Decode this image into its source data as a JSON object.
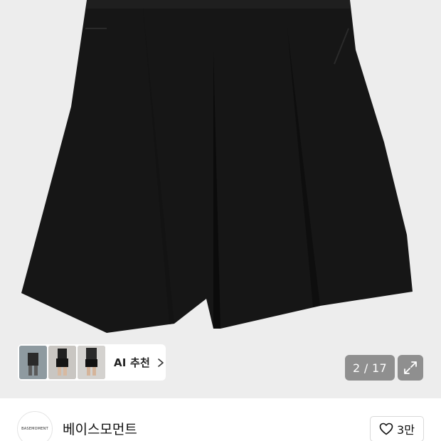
{
  "gallery": {
    "recommend_label": "AI 추천",
    "counter": "2 / 17",
    "thumbnails": [
      "thumbnail-1",
      "thumbnail-2",
      "thumbnail-3"
    ],
    "icons": {
      "chevron": "chevron-right-icon",
      "expand": "expand-icon"
    }
  },
  "brand": {
    "name": "베이스모먼트",
    "logo_text": "BASEMOMENT"
  },
  "like": {
    "count": "3만",
    "icon": "heart-outline-icon"
  },
  "colors": {
    "background": "#ededed",
    "product": "#161616",
    "overlay_button": "#8f8f8f",
    "text": "#111111"
  }
}
